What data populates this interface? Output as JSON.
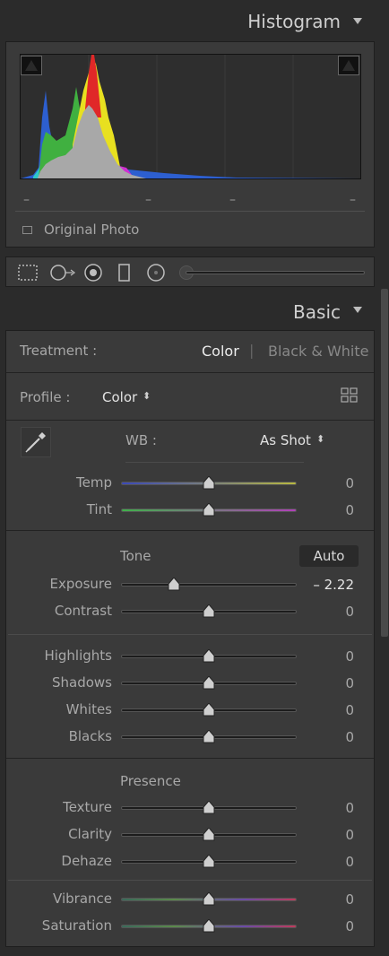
{
  "histogram": {
    "title": "Histogram",
    "dashes": [
      "–",
      "–",
      "–",
      "–"
    ],
    "original_photo_label": "Original Photo"
  },
  "tools": [
    "crop-icon",
    "spot-removal-icon",
    "red-eye-icon",
    "graduated-filter-icon",
    "radial-filter-icon",
    "brush-size-slider"
  ],
  "basic": {
    "title": "Basic",
    "treatment": {
      "label": "Treatment :",
      "color": "Color",
      "separator": "|",
      "bw": "Black & White"
    },
    "profile": {
      "label": "Profile :",
      "value": "Color",
      "arrows": "⬍"
    },
    "wb": {
      "label": "WB :",
      "value": "As Shot",
      "arrows": "⬍"
    },
    "tone_label": "Tone",
    "auto_label": "Auto",
    "presence_label": "Presence",
    "sliders": {
      "temp": {
        "label": "Temp",
        "value": "0",
        "level": 0.5
      },
      "tint": {
        "label": "Tint",
        "value": "0",
        "level": 0.5
      },
      "exposure": {
        "label": "Exposure",
        "value": "– 2.22",
        "level": 0.3
      },
      "contrast": {
        "label": "Contrast",
        "value": "0",
        "level": 0.5
      },
      "highlights": {
        "label": "Highlights",
        "value": "0",
        "level": 0.5
      },
      "shadows": {
        "label": "Shadows",
        "value": "0",
        "level": 0.5
      },
      "whites": {
        "label": "Whites",
        "value": "0",
        "level": 0.5
      },
      "blacks": {
        "label": "Blacks",
        "value": "0",
        "level": 0.5
      },
      "texture": {
        "label": "Texture",
        "value": "0",
        "level": 0.5
      },
      "clarity": {
        "label": "Clarity",
        "value": "0",
        "level": 0.5
      },
      "dehaze": {
        "label": "Dehaze",
        "value": "0",
        "level": 0.5
      },
      "vibrance": {
        "label": "Vibrance",
        "value": "0",
        "level": 0.5
      },
      "saturation": {
        "label": "Saturation",
        "value": "0",
        "level": 0.5
      }
    }
  },
  "colors": {
    "panel": "#3a3a3a",
    "track_temp": [
      "#3a48b8",
      "#b8b840"
    ],
    "track_tint": [
      "#3fb04a",
      "#b040b8"
    ],
    "track_vibrance": [
      "#3a7a6a",
      "#c03a6a"
    ]
  }
}
